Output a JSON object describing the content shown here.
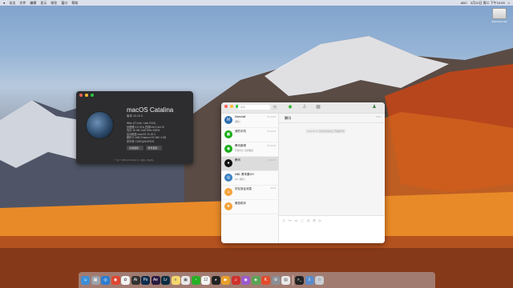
{
  "menubar": {
    "app": "",
    "items": [
      "访达",
      "文件",
      "编辑",
      "显示",
      "前往",
      "窗口",
      "帮助"
    ],
    "clock": "3月10日 周二 下午10:59",
    "status": "ABC"
  },
  "desktop": {
    "drive_label": "Macintosh HD"
  },
  "about": {
    "title": "macOS Catalina",
    "version": "版本 10.15.3",
    "specs": [
      "iMac (27-inch, Late 2013)",
      "处理器 3.5 GHz 四核Intel Core i5",
      "内存 16 GB 2400 MHz DDR4",
      "启动磁盘 macOS 10.15.3",
      "图形卡 AMD Radeon RX 560 4 GB",
      "序列号 C02RQAK3F8J3"
    ],
    "btn_report": "系统报告...",
    "btn_update": "软件更新...",
    "copyright": "™ 和 © 1983-2020 Apple Inc. 保留一切权利。"
  },
  "wechat": {
    "search_placeholder": "搜索",
    "current_chat": "腾讯",
    "system_message": "02-26 07:12 已成为你的好友,开始聊天吧",
    "chats": [
      {
        "name": "Marshall",
        "preview": "[图片]",
        "time": "下午10:26",
        "color": "#2b6cb0",
        "glyph": "M"
      },
      {
        "name": "我的手机",
        "preview": "",
        "time": "下午10:02",
        "color": "#1aad19",
        "glyph": "▣"
      },
      {
        "name": "腾讯新闻",
        "preview": "开放平台: 新闻推送",
        "time": "下午10:00",
        "color": "#1aad19",
        "glyph": "◉"
      },
      {
        "name": "腾讯",
        "preview": "",
        "time": "上午11:03",
        "color": "#111111",
        "glyph": "●"
      },
      {
        "name": "MBL 黑苹果DIY",
        "preview": "abc: [图片]",
        "time": "",
        "color": "#3b82c4",
        "glyph": "◎"
      },
      {
        "name": "好友验证消息",
        "preview": "",
        "time": "02-26",
        "color": "#f3a33b",
        "glyph": "☺"
      },
      {
        "name": "微信助手",
        "preview": "",
        "time": "",
        "color": "#f3a33b",
        "glyph": "★"
      }
    ]
  },
  "dock": {
    "apps": [
      {
        "name": "finder",
        "color": "#3d8fd9",
        "glyph": "☺"
      },
      {
        "name": "launchpad",
        "color": "#9aa3ad",
        "glyph": "▦"
      },
      {
        "name": "safari",
        "color": "#2d7dd2",
        "glyph": "◎"
      },
      {
        "name": "chrome",
        "color": "#e0452f",
        "glyph": "◉"
      },
      {
        "name": "photos",
        "color": "#f2f2f2",
        "glyph": "✿"
      },
      {
        "name": "ai",
        "color": "#333333",
        "glyph": "Ai"
      },
      {
        "name": "ps",
        "color": "#0d2c4d",
        "glyph": "Ps"
      },
      {
        "name": "ae",
        "color": "#2b1a40",
        "glyph": "Ae"
      },
      {
        "name": "lr",
        "color": "#0c2d42",
        "glyph": "Lr"
      },
      {
        "name": "notes",
        "color": "#f5d76e",
        "glyph": "≡"
      },
      {
        "name": "preview",
        "color": "#e9e9e9",
        "glyph": "▣"
      },
      {
        "name": "wechat",
        "color": "#26b026",
        "glyph": "◔"
      },
      {
        "name": "calendar",
        "color": "#f4f4f4",
        "glyph": "12"
      },
      {
        "name": "qq",
        "color": "#222222",
        "glyph": "◕"
      },
      {
        "name": "infuse",
        "color": "#e8a02b",
        "glyph": "▶"
      },
      {
        "name": "netease-music",
        "color": "#d0312d",
        "glyph": "♫"
      },
      {
        "name": "podcast",
        "color": "#9b59d0",
        "glyph": "◉"
      },
      {
        "name": "maps",
        "color": "#5aa455",
        "glyph": "◈"
      },
      {
        "name": "k-app",
        "color": "#e34a2c",
        "glyph": "K"
      },
      {
        "name": "settings",
        "color": "#8a8f96",
        "glyph": "⚙"
      },
      {
        "name": "notes2",
        "color": "#eaeaea",
        "glyph": "▤"
      },
      {
        "name": "terminal",
        "color": "#222222",
        "glyph": ">_"
      },
      {
        "name": "downloads",
        "color": "#5b8ccb",
        "glyph": "⇩"
      },
      {
        "name": "trash",
        "color": "#c9ced4",
        "glyph": "♲"
      }
    ]
  }
}
